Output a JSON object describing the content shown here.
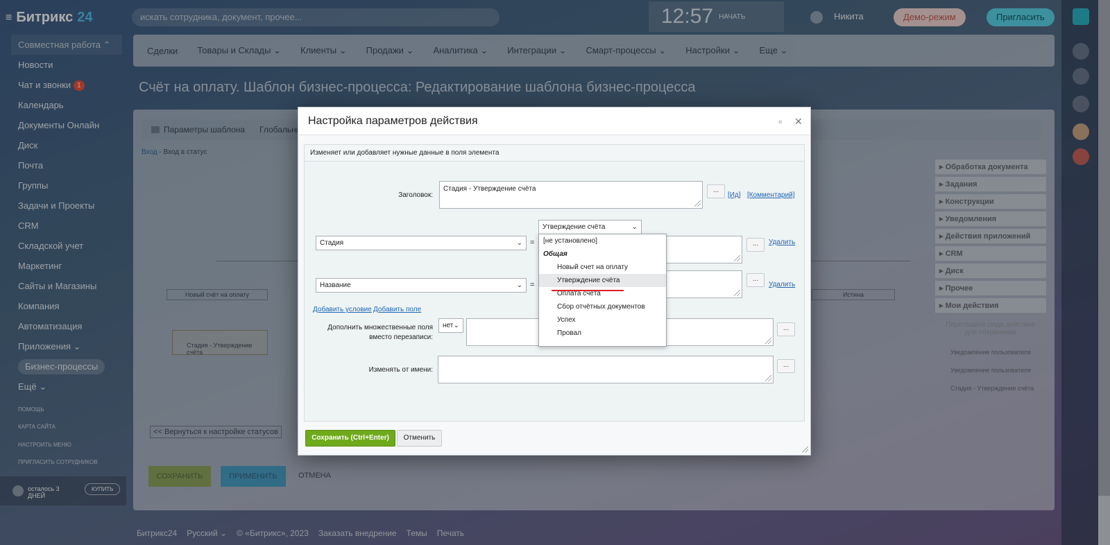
{
  "app": {
    "logo_text": "Битрикс",
    "logo_num": "24"
  },
  "sidebar": {
    "items": [
      {
        "label": "Совместная работа ⌃",
        "group": true
      },
      {
        "label": "Новости"
      },
      {
        "label": "Чат и звонки",
        "badge": "1"
      },
      {
        "label": "Календарь"
      },
      {
        "label": "Документы Онлайн"
      },
      {
        "label": "Диск"
      },
      {
        "label": "Почта"
      },
      {
        "label": "Группы"
      },
      {
        "label": "Задачи и Проекты"
      },
      {
        "label": "CRM"
      },
      {
        "label": "Складской учет"
      },
      {
        "label": "Маркетинг"
      },
      {
        "label": "Сайты и Магазины"
      },
      {
        "label": "Компания"
      },
      {
        "label": "Автоматизация"
      },
      {
        "label": "Приложения ⌄"
      },
      {
        "label": "Бизнес-процессы",
        "active": true
      },
      {
        "label": "Ещё ⌄"
      }
    ],
    "small_links": [
      "ПОМОЩЬ",
      "КАРТА САЙТА",
      "НАСТРОИТЬ МЕНЮ",
      "ПРИГЛАСИТЬ СОТРУДНИКОВ"
    ],
    "trial_text": "осталось 3 ДНЕЙ",
    "buy_label": "КУПИТЬ"
  },
  "header": {
    "search_placeholder": "искать сотрудника, документ, прочее...",
    "time": "12:57",
    "start_label": "НАЧАТЬ",
    "user_name": "Никита",
    "demo_label": "Демо-режим",
    "invite_label": "Пригласить"
  },
  "nav": {
    "items": [
      "Сделки",
      "Товары и Склады ⌄",
      "Клиенты ⌄",
      "Продажи ⌄",
      "Аналитика ⌄",
      "Интеграции ⌄",
      "Смарт-процессы ⌄",
      "Настройки ⌄",
      "Еще ⌄"
    ]
  },
  "page": {
    "title": "Счёт на оплату. Шаблон бизнес-процесса: Редактирование шаблона бизнес-процесса",
    "tab_params": "Параметры шаблона",
    "tab_global": "Глобальны",
    "breadcrumb_link": "Вход",
    "breadcrumb_rest": " - Вход в статус",
    "node_left": "Новый счёт на оплату",
    "node_right": "Истина",
    "activity_label": "Стадия - Утверждение счёта",
    "back_button": "<< Вернуться к настройке статусов",
    "save": "СОХРАНИТЬ",
    "apply": "ПРИМЕНИТЬ",
    "cancel": "ОТМЕНА"
  },
  "right_panel": {
    "items": [
      "Обработка документа",
      "Задания",
      "Конструкции",
      "Уведомления",
      "Действия приложений",
      "CRM",
      "Диск",
      "Прочее",
      "Мои действия"
    ],
    "hint": "Перетащите сюда действие для сохранения",
    "my_actions": [
      "Уведомление пользователя",
      "Уведомление пользователя",
      "Стадия - Утверждение счёта"
    ]
  },
  "dialog": {
    "title": "Настройка параметров действия",
    "description": "Изменяет или добавляет нужные данные в поля элемента",
    "title_label": "Заголовок:",
    "title_value": "Стадия - Утверждение счёта",
    "dots": "...",
    "id_link": "[Ид]",
    "comment_link": "[Комментарий]",
    "field1": "Стадия",
    "field2": "Название",
    "eq": "=",
    "stage_select_value": "Утверждение счёта",
    "delete_label": "Удалить",
    "add_condition": "Добавить условие",
    "add_field": "Добавить поле",
    "multi_label": "Дополнить множественные поля вместо перезаписи:",
    "multi_value": "нет",
    "change_from_label": "Изменять от имени:",
    "save_button": "Сохранить (Ctrl+Enter)",
    "cancel_button": "Отменить",
    "dropdown": {
      "not_set": "[не установлено]",
      "group": "Общая",
      "options": [
        "Новый счет на оплату",
        "Утверждение счёта",
        "Оплата счёта",
        "Сбор отчётных документов",
        "Успех",
        "Провал"
      ],
      "highlighted_index": 1
    }
  },
  "footer": {
    "items": [
      "Битрикс24",
      "Русский ⌄",
      "© «Битрикс», 2023",
      "Заказать внедрение",
      "Темы",
      "Печать"
    ]
  }
}
